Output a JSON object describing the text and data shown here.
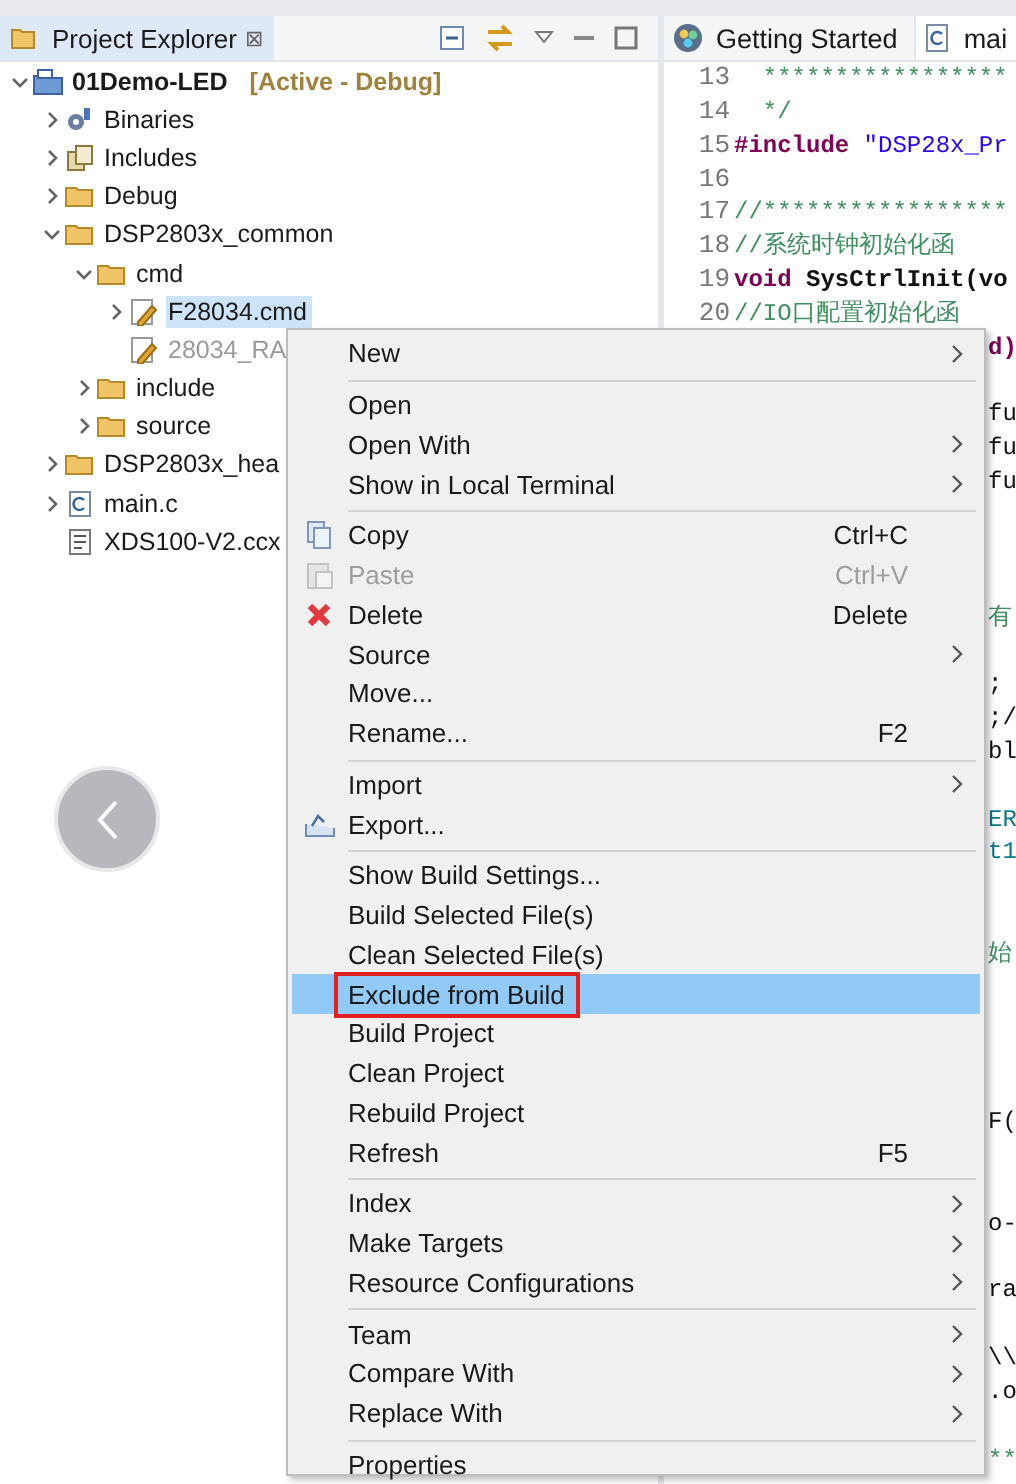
{
  "explorer": {
    "tab": {
      "label": "Project Explorer",
      "close": "⊠",
      "selected": true
    },
    "tree": [
      {
        "label": "01Demo-LED",
        "kind": "project",
        "badge": "[Active - Debug]",
        "expanded": true,
        "children": [
          {
            "label": "Binaries",
            "kind": "binaries",
            "expanded": false
          },
          {
            "label": "Includes",
            "kind": "includes",
            "expanded": false
          },
          {
            "label": "Debug",
            "kind": "folder",
            "expanded": false
          },
          {
            "label": "DSP2803x_common",
            "kind": "folder",
            "expanded": true,
            "children": [
              {
                "label": "cmd",
                "kind": "folder",
                "expanded": true,
                "children": [
                  {
                    "label": "F28034.cmd",
                    "kind": "cmd",
                    "expanded": false,
                    "selected": true,
                    "excluded": false
                  },
                  {
                    "label": "28034_RA",
                    "kind": "cmd",
                    "selected": false,
                    "excluded": true
                  }
                ]
              },
              {
                "label": "include",
                "kind": "folder",
                "expanded": false
              },
              {
                "label": "source",
                "kind": "folder",
                "expanded": false
              }
            ]
          },
          {
            "label": "DSP2803x_hea",
            "kind": "folder",
            "expanded": false
          },
          {
            "label": "main.c",
            "kind": "cfile",
            "expanded": false
          },
          {
            "label": "XDS100-V2.ccx",
            "kind": "target"
          }
        ]
      }
    ]
  },
  "editor": {
    "tabs": [
      {
        "label": "Getting Started",
        "kind": "welcome",
        "selected": false
      },
      {
        "label": "mai",
        "kind": "cfile",
        "selected": true
      }
    ],
    "lines": [
      {
        "kind": "full",
        "number": "13",
        "segments": [
          {
            "text": "  *****************",
            "kind": "comment"
          }
        ]
      },
      {
        "kind": "full",
        "number": "14",
        "segments": [
          {
            "text": "  */",
            "kind": "comment"
          }
        ]
      },
      {
        "kind": "full",
        "number": "15",
        "segments": [
          {
            "text": "#include",
            "kind": "keyword"
          },
          {
            "text": " \"DSP28x_Pr",
            "kind": "string"
          }
        ]
      },
      {
        "kind": "full",
        "number": "16"
      },
      {
        "kind": "full",
        "number": "17",
        "segments": [
          {
            "text": "//*****************",
            "kind": "comment"
          }
        ]
      },
      {
        "kind": "full",
        "number": "18",
        "segments": [
          {
            "text": "//系统时钟初始化函",
            "kind": "comment"
          }
        ]
      },
      {
        "kind": "full",
        "number": "19",
        "segments": [
          {
            "text": "void",
            "kind": "keyword"
          },
          {
            "text": " SysCtrlInit(vo",
            "kind": "bold"
          }
        ]
      },
      {
        "kind": "full",
        "number": "20",
        "segments": [
          {
            "text": "//IO口配置初始化函",
            "kind": "comment"
          }
        ]
      },
      {
        "kind": "edge",
        "segments": [
          {
            "text": "d)",
            "kind": "keyword"
          }
        ]
      },
      {
        "kind": "blank"
      },
      {
        "kind": "edge",
        "segments": [
          {
            "text": "fu",
            "kind": "plain"
          }
        ]
      },
      {
        "kind": "edge",
        "segments": [
          {
            "text": "fu",
            "kind": "plain"
          }
        ]
      },
      {
        "kind": "edge",
        "segments": [
          {
            "text": "fu",
            "kind": "plain"
          }
        ]
      },
      {
        "kind": "blank"
      },
      {
        "kind": "blank"
      },
      {
        "kind": "blank"
      },
      {
        "kind": "edge",
        "segments": [
          {
            "text": "有",
            "kind": "comment"
          }
        ]
      },
      {
        "kind": "blank"
      },
      {
        "kind": "edge",
        "segments": [
          {
            "text": ";",
            "kind": "plain"
          }
        ]
      },
      {
        "kind": "edge",
        "segments": [
          {
            "text": ";/",
            "kind": "plain"
          }
        ]
      },
      {
        "kind": "edge",
        "segments": [
          {
            "text": "bl",
            "kind": "plain"
          }
        ]
      },
      {
        "kind": "blank"
      },
      {
        "kind": "edge",
        "segments": [
          {
            "text": "ER",
            "kind": "macro"
          }
        ]
      },
      {
        "kind": "edge",
        "segments": [
          {
            "text": "t1",
            "kind": "macro"
          }
        ]
      },
      {
        "kind": "blank"
      },
      {
        "kind": "blank"
      },
      {
        "kind": "edge",
        "segments": [
          {
            "text": "始",
            "kind": "comment"
          }
        ]
      },
      {
        "kind": "blank"
      },
      {
        "kind": "blank"
      },
      {
        "kind": "blank"
      },
      {
        "kind": "blank"
      },
      {
        "kind": "edge",
        "segments": [
          {
            "text": "F(",
            "kind": "plain"
          }
        ]
      },
      {
        "kind": "blank"
      },
      {
        "kind": "blank"
      },
      {
        "kind": "edge",
        "segments": [
          {
            "text": "o-",
            "kind": "plain"
          }
        ]
      },
      {
        "kind": "blank"
      },
      {
        "kind": "edge",
        "segments": [
          {
            "text": "ra",
            "kind": "plain"
          }
        ]
      },
      {
        "kind": "blank"
      },
      {
        "kind": "edge",
        "segments": [
          {
            "text": "\\\\",
            "kind": "plain"
          }
        ]
      },
      {
        "kind": "edge",
        "segments": [
          {
            "text": ".o",
            "kind": "plain"
          }
        ]
      },
      {
        "kind": "blank"
      },
      {
        "kind": "edge",
        "segments": [
          {
            "text": "**",
            "kind": "comment"
          }
        ]
      }
    ]
  },
  "context_menu": {
    "groups": [
      [
        {
          "label": "New",
          "submenu": true
        }
      ],
      [
        {
          "label": "Open"
        },
        {
          "label": "Open With",
          "submenu": true
        },
        {
          "label": "Show in Local Terminal",
          "submenu": true
        }
      ],
      [
        {
          "label": "Copy",
          "kind": "copy",
          "shortcut": "Ctrl+C"
        },
        {
          "label": "Paste",
          "kind": "paste",
          "shortcut": "Ctrl+V",
          "disabled": true
        },
        {
          "label": "Delete",
          "kind": "delete",
          "shortcut": "Delete"
        },
        {
          "label": "Source",
          "submenu": true
        },
        {
          "label": "Move..."
        },
        {
          "label": "Rename...",
          "shortcut": "F2"
        }
      ],
      [
        {
          "label": "Import",
          "submenu": true
        },
        {
          "label": "Export...",
          "kind": "export"
        }
      ],
      [
        {
          "label": "Show Build Settings..."
        },
        {
          "label": "Build Selected File(s)"
        },
        {
          "label": "Clean Selected File(s)"
        },
        {
          "label": "Exclude from Build",
          "selected": true,
          "annotated": true
        },
        {
          "label": "Build Project"
        },
        {
          "label": "Clean Project"
        },
        {
          "label": "Rebuild Project"
        },
        {
          "label": "Refresh",
          "shortcut": "F5"
        }
      ],
      [
        {
          "label": "Index",
          "submenu": true
        },
        {
          "label": "Make Targets",
          "submenu": true
        },
        {
          "label": "Resource Configurations",
          "submenu": true
        }
      ],
      [
        {
          "label": "Team",
          "submenu": true
        },
        {
          "label": "Compare With",
          "submenu": true
        },
        {
          "label": "Replace With",
          "submenu": true
        }
      ],
      [
        {
          "label": "Properties"
        }
      ]
    ]
  }
}
